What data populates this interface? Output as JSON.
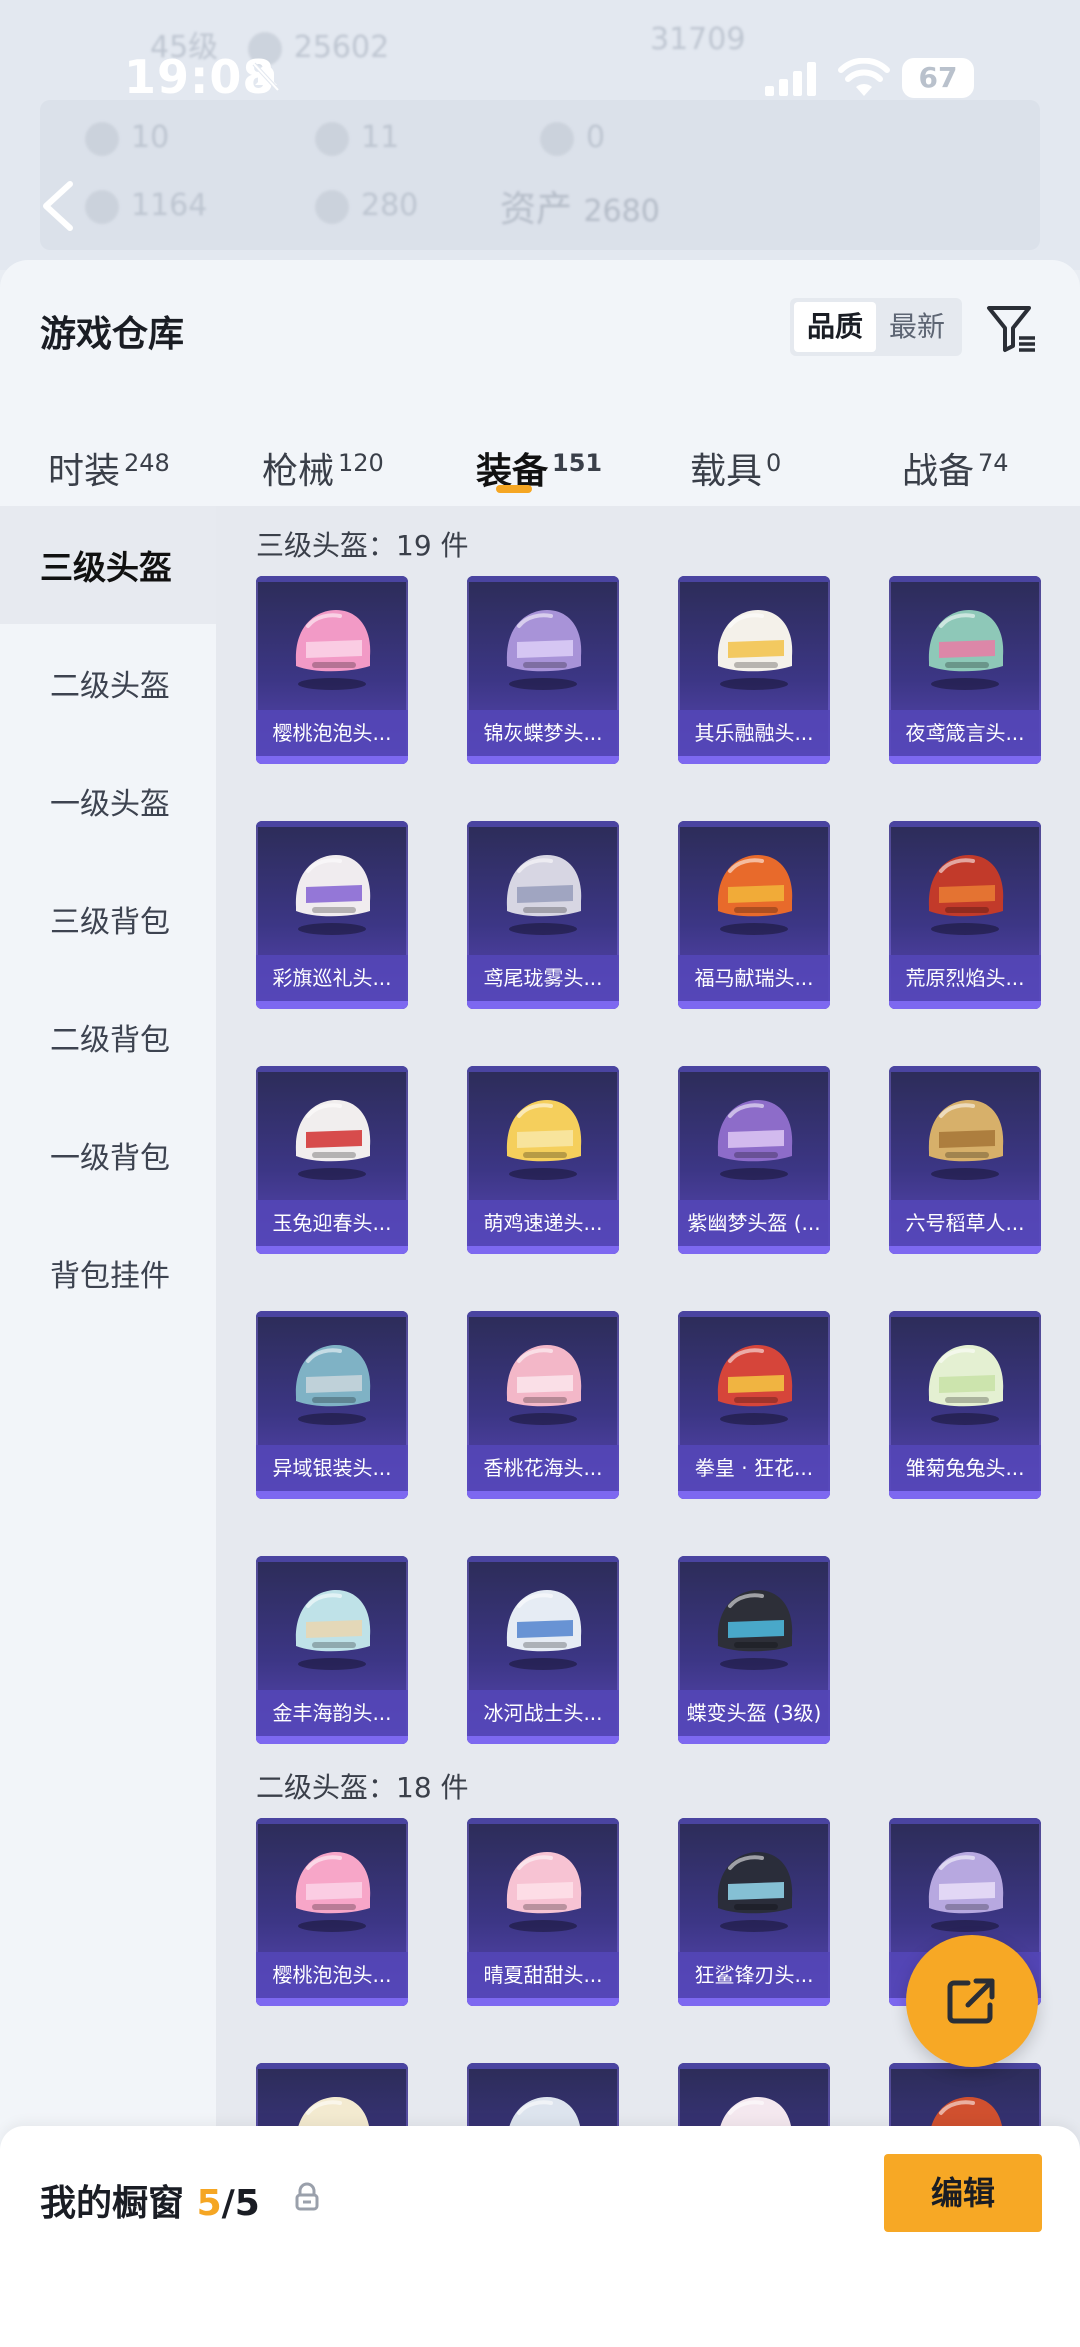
{
  "status_bar": {
    "time": "19:08",
    "battery": "67"
  },
  "background": {
    "level": "45级",
    "coins": "25602",
    "score": "31709",
    "stats_row1": [
      "10",
      "11",
      "0"
    ],
    "stats_row2": [
      "1164",
      "280"
    ],
    "assets_label": "资产",
    "assets_value": "2680"
  },
  "sheet": {
    "title": "游戏仓库",
    "sort_options": [
      "品质",
      "最新"
    ],
    "active_sort": "品质"
  },
  "tabs": [
    {
      "label": "时装",
      "count": "248"
    },
    {
      "label": "枪械",
      "count": "120"
    },
    {
      "label": "装备",
      "count": "151"
    },
    {
      "label": "载具",
      "count": "0"
    },
    {
      "label": "战备",
      "count": "74"
    }
  ],
  "active_tab": "装备",
  "sidebar": [
    "三级头盔",
    "二级头盔",
    "一级头盔",
    "三级背包",
    "二级背包",
    "一级背包",
    "背包挂件"
  ],
  "active_sidebar": "三级头盔",
  "sections": [
    {
      "title": "三级头盔：19 件",
      "items": [
        {
          "name": "樱桃泡泡头...",
          "color": "#f29ac6",
          "accent": "#fbd2e5"
        },
        {
          "name": "锦灰蝶梦头...",
          "color": "#a893d8",
          "accent": "#d9ccf6"
        },
        {
          "name": "其乐融融头...",
          "color": "#f4f1ea",
          "accent": "#f3c451"
        },
        {
          "name": "夜鸢箴言头...",
          "color": "#8ec8b8",
          "accent": "#e47fa6"
        },
        {
          "name": "彩旗巡礼头...",
          "color": "#f0ecef",
          "accent": "#8a6ad4"
        },
        {
          "name": "鸢尾珑雾头...",
          "color": "#d7d6e3",
          "accent": "#9aa0bd"
        },
        {
          "name": "福马献瑞头...",
          "color": "#e86a2b",
          "accent": "#f2b23a"
        },
        {
          "name": "荒原烈焰头...",
          "color": "#c23a2a",
          "accent": "#e87a33"
        },
        {
          "name": "玉兔迎春头...",
          "color": "#f1eeee",
          "accent": "#d43a3a"
        },
        {
          "name": "萌鸡速递头...",
          "color": "#f5cf5c",
          "accent": "#f8e6a3"
        },
        {
          "name": "紫幽梦头盔 (...",
          "color": "#8d6cc9",
          "accent": "#d9c3f2"
        },
        {
          "name": "六号稻草人...",
          "color": "#d7b06a",
          "accent": "#a9793a"
        },
        {
          "name": "异域银装头...",
          "color": "#7fb2c5",
          "accent": "#c7d4da"
        },
        {
          "name": "香桃花海头...",
          "color": "#f3b7c8",
          "accent": "#fbe3ea"
        },
        {
          "name": "拳皇 · 狂花...",
          "color": "#d6453a",
          "accent": "#f3c043"
        },
        {
          "name": "雏菊兔兔头...",
          "color": "#e4f0d2",
          "accent": "#c9e2a8"
        },
        {
          "name": "金丰海韵头...",
          "color": "#bfe2e8",
          "accent": "#e8d7b3"
        },
        {
          "name": "冰河战士头...",
          "color": "#e6ecf4",
          "accent": "#5a8ad0"
        },
        {
          "name": "蝶变头盔 (3级)",
          "color": "#2d2f38",
          "accent": "#4cb6d9"
        }
      ]
    },
    {
      "title": "二级头盔：18 件",
      "items": [
        {
          "name": "樱桃泡泡头...",
          "color": "#f7a6c8",
          "accent": "#fbd2e5"
        },
        {
          "name": "晴夏甜甜头...",
          "color": "#f7c3d3",
          "accent": "#fde0e8"
        },
        {
          "name": "狂鲨锋刃头...",
          "color": "#2a2d3a",
          "accent": "#8fd0e6"
        },
        {
          "name": "",
          "color": "#b7a8e0",
          "accent": "#e7dcf7"
        },
        {
          "name": "",
          "color": "#f3ead0",
          "accent": "#f5c85a"
        },
        {
          "name": "",
          "color": "#dde4ee",
          "accent": "#a2abc0"
        },
        {
          "name": "",
          "color": "#f4e8ef",
          "accent": "#b88ee6"
        },
        {
          "name": "",
          "color": "#d0502f",
          "accent": "#f09a44"
        }
      ]
    }
  ],
  "bottom_bar": {
    "label": "我的橱窗",
    "count": "5",
    "total": "/5",
    "edit_label": "编辑"
  }
}
